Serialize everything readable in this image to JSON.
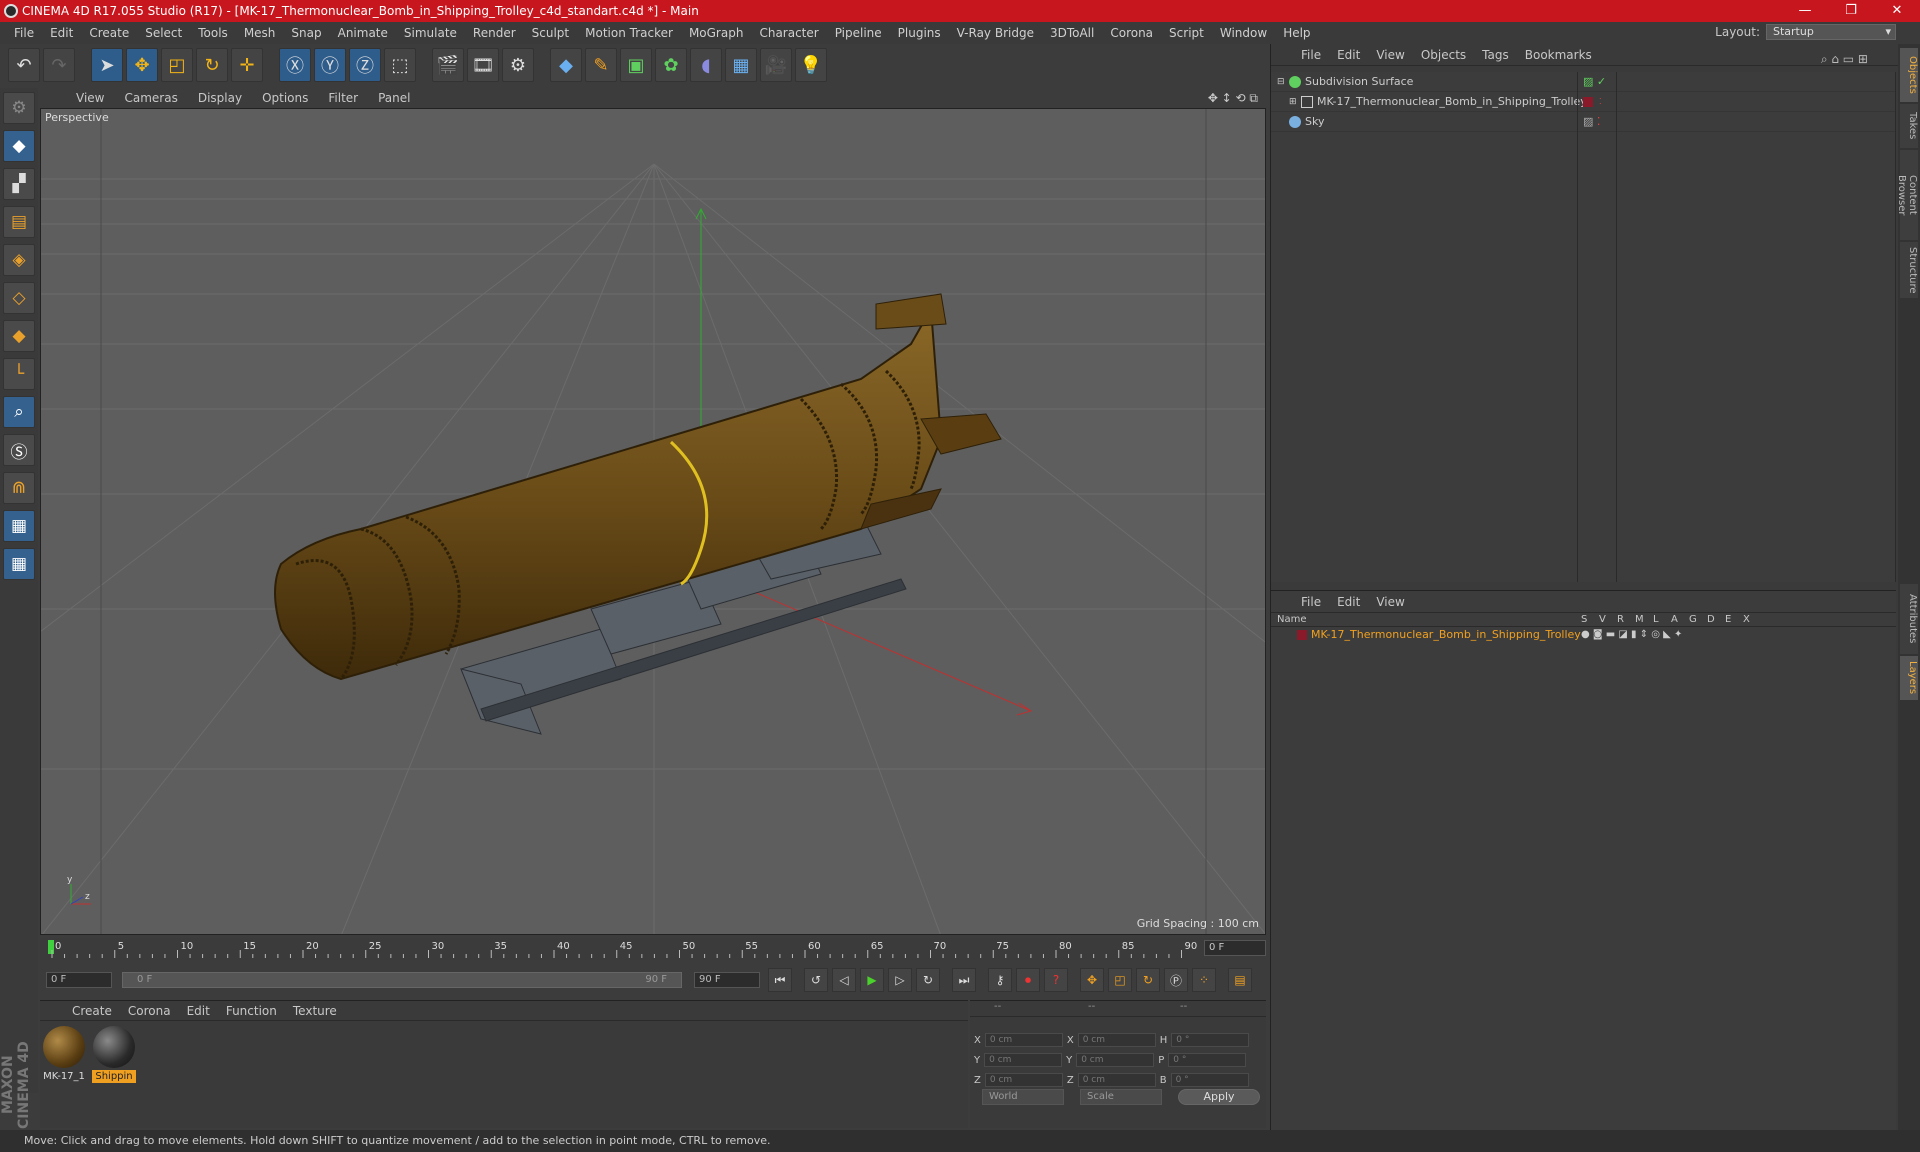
{
  "window": {
    "title": "CINEMA 4D R17.055 Studio (R17) - [MK-17_Thermonuclear_Bomb_in_Shipping_Trolley_c4d_standart.c4d *] - Main",
    "controls": [
      "—",
      "❐",
      "✕"
    ]
  },
  "menu": [
    "File",
    "Edit",
    "Create",
    "Select",
    "Tools",
    "Mesh",
    "Snap",
    "Animate",
    "Simulate",
    "Render",
    "Sculpt",
    "Motion Tracker",
    "MoGraph",
    "Character",
    "Pipeline",
    "Plugins",
    "V-Ray Bridge",
    "3DToAll",
    "Corona",
    "Script",
    "Window",
    "Help"
  ],
  "layout": {
    "label": "Layout:",
    "value": "Startup"
  },
  "viewport": {
    "menu": [
      "View",
      "Cameras",
      "Display",
      "Options",
      "Filter",
      "Panel"
    ],
    "label": "Perspective",
    "grid_spacing": "Grid Spacing : 100 cm"
  },
  "timeline": {
    "ticks": [
      "0",
      "5",
      "10",
      "15",
      "20",
      "25",
      "30",
      "35",
      "40",
      "45",
      "50",
      "55",
      "60",
      "65",
      "70",
      "75",
      "80",
      "85",
      "90"
    ],
    "current_frame": "0 F",
    "start_field": "0 F",
    "slider_start": "0 F",
    "slider_end": "90 F",
    "end_field": "90 F"
  },
  "materials": {
    "menu": [
      "Create",
      "Corona",
      "Edit",
      "Function",
      "Texture"
    ],
    "items": [
      {
        "label": "MK-17_1",
        "color": "#6a4a1c",
        "selected": false
      },
      {
        "label": "Shippin",
        "color": "#2a2a2a",
        "selected": true
      }
    ]
  },
  "coordinates": {
    "header": [
      "--",
      "--",
      "--"
    ],
    "rows": [
      {
        "a": "X",
        "av": "0 cm",
        "b": "X",
        "bv": "0 cm",
        "c": "H",
        "cv": "0 °"
      },
      {
        "a": "Y",
        "av": "0 cm",
        "b": "Y",
        "bv": "0 cm",
        "c": "P",
        "cv": "0 °"
      },
      {
        "a": "Z",
        "av": "0 cm",
        "b": "Z",
        "bv": "0 cm",
        "c": "B",
        "cv": "0 °"
      }
    ],
    "mode": "World",
    "scale": "Scale",
    "apply": "Apply"
  },
  "status": "Move: Click and drag to move elements. Hold down SHIFT to quantize movement / add to the selection in point mode, CTRL to remove.",
  "object_manager": {
    "menu": [
      "File",
      "Edit",
      "View",
      "Objects",
      "Tags",
      "Bookmarks"
    ],
    "objects": [
      {
        "name": "Subdivision Surface",
        "icon_color": "#5fcf5f"
      },
      {
        "name": "MK-17_Thermonuclear_Bomb_in_Shipping_Trolley",
        "icon_color": "#cccccc"
      },
      {
        "name": "Sky",
        "icon_color": "#7ab0e0"
      }
    ]
  },
  "layer_manager": {
    "menu": [
      "File",
      "Edit",
      "View"
    ],
    "columns": [
      "Name",
      "S",
      "V",
      "R",
      "M",
      "L",
      "A",
      "G",
      "D",
      "E",
      "X"
    ],
    "layers": [
      {
        "name": "MK-17_Thermonuclear_Bomb_in_Shipping_Trolley"
      }
    ]
  },
  "side_tabs": [
    "Objects",
    "Takes",
    "Content Browser",
    "Structure",
    "Attributes",
    "Layers"
  ],
  "brand": "MAXON CINEMA 4D"
}
